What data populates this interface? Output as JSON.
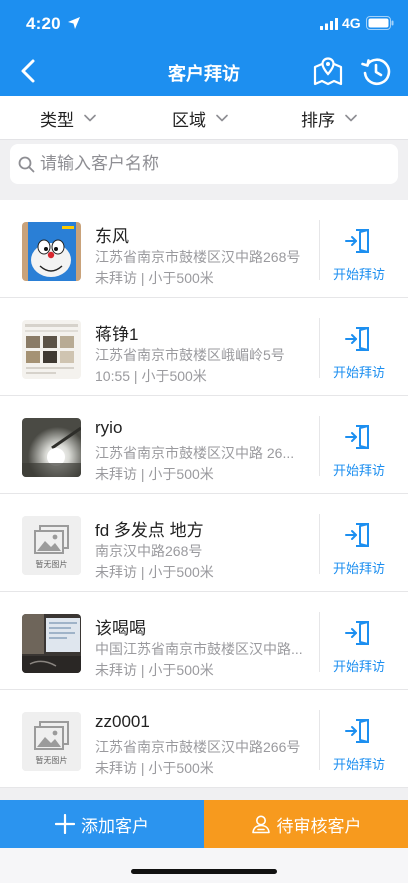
{
  "status_bar": {
    "time": "4:20",
    "network": "4G"
  },
  "header": {
    "title": "客户拜访"
  },
  "filters": [
    {
      "label": "类型"
    },
    {
      "label": "区域"
    },
    {
      "label": "排序"
    }
  ],
  "search": {
    "placeholder": "请输入客户名称",
    "value": ""
  },
  "customers": [
    {
      "name": "东风",
      "address": "江苏省南京市鼓楼区汉中路268号",
      "meta": "未拜访 | 小于500米",
      "thumb": "doraemon-photo"
    },
    {
      "name": "蒋铮1",
      "address": "江苏省南京市鼓楼区峨嵋岭5号",
      "meta": "10:55 | 小于500米",
      "thumb": "collage-photo"
    },
    {
      "name": "ryio",
      "address": "江苏省南京市鼓楼区汉中路 26...",
      "meta": "未拜访 | 小于500米",
      "thumb": "lamp-photo"
    },
    {
      "name": "fd 多发点 地方",
      "address": "南京汉中路268号",
      "meta": "未拜访 | 小于500米",
      "thumb": "placeholder",
      "thumb_text": "暂无图片"
    },
    {
      "name": "该喝喝",
      "address": "中国江苏省南京市鼓楼区汉中路...",
      "meta": "未拜访 | 小于500米",
      "thumb": "monitor-photo"
    },
    {
      "name": "zz0001",
      "address": "江苏省南京市鼓楼区汉中路266号",
      "meta": "未拜访 | 小于500米",
      "thumb": "placeholder",
      "thumb_text": "暂无图片"
    }
  ],
  "visit_label": "开始拜访",
  "bottom": {
    "add_label": "添加客户",
    "pending_label": "待审核客户"
  },
  "colors": {
    "primary": "#1d8ff0",
    "orange": "#f79a1e",
    "add_blue": "#2b94ef"
  }
}
